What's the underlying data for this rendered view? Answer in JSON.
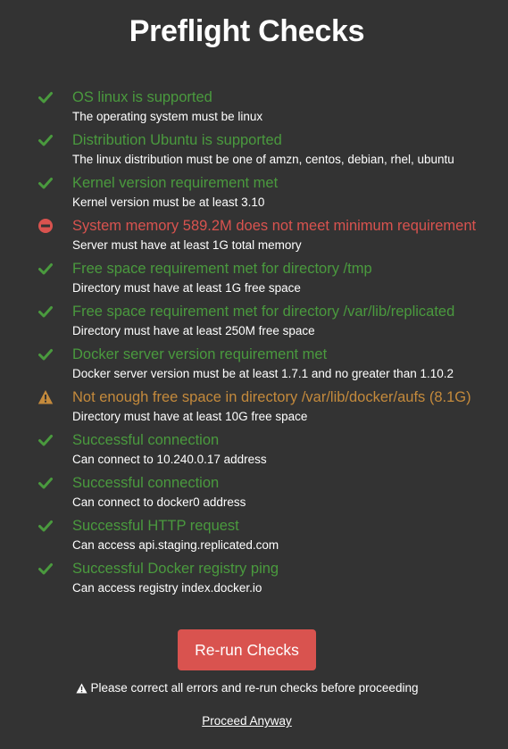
{
  "page": {
    "title": "Preflight Checks"
  },
  "colors": {
    "background": "#333333",
    "pass": "#4a9a3e",
    "fail": "#d9534f",
    "warn": "#c48a3c",
    "button": "#d9534f"
  },
  "checks": [
    {
      "status": "pass",
      "icon": "checkmark-icon",
      "title": "OS linux is supported",
      "description": "The operating system must be linux"
    },
    {
      "status": "pass",
      "icon": "checkmark-icon",
      "title": "Distribution Ubuntu is supported",
      "description": "The linux distribution must be one of amzn, centos, debian, rhel, ubuntu"
    },
    {
      "status": "pass",
      "icon": "checkmark-icon",
      "title": "Kernel version requirement met",
      "description": "Kernel version must be at least 3.10"
    },
    {
      "status": "fail",
      "icon": "minus-circle-icon",
      "title": "System memory 589.2M does not meet minimum requirement",
      "description": "Server must have at least 1G total memory"
    },
    {
      "status": "pass",
      "icon": "checkmark-icon",
      "title": "Free space requirement met for directory /tmp",
      "description": "Directory must have at least 1G free space"
    },
    {
      "status": "pass",
      "icon": "checkmark-icon",
      "title": "Free space requirement met for directory /var/lib/replicated",
      "description": "Directory must have at least 250M free space"
    },
    {
      "status": "pass",
      "icon": "checkmark-icon",
      "title": "Docker server version requirement met",
      "description": "Docker server version must be at least 1.7.1 and no greater than 1.10.2"
    },
    {
      "status": "warn",
      "icon": "warning-triangle-icon",
      "title": "Not enough free space in directory /var/lib/docker/aufs (8.1G)",
      "description": "Directory must have at least 10G free space"
    },
    {
      "status": "pass",
      "icon": "checkmark-icon",
      "title": "Successful connection",
      "description": "Can connect to 10.240.0.17 address"
    },
    {
      "status": "pass",
      "icon": "checkmark-icon",
      "title": "Successful connection",
      "description": "Can connect to docker0 address"
    },
    {
      "status": "pass",
      "icon": "checkmark-icon",
      "title": "Successful HTTP request",
      "description": "Can access api.staging.replicated.com"
    },
    {
      "status": "pass",
      "icon": "checkmark-icon",
      "title": "Successful Docker registry ping",
      "description": "Can access registry index.docker.io"
    }
  ],
  "actions": {
    "rerun_label": "Re-run Checks",
    "warning_text": "Please correct all errors and re-run checks before proceeding",
    "proceed_label": "Proceed Anyway"
  }
}
